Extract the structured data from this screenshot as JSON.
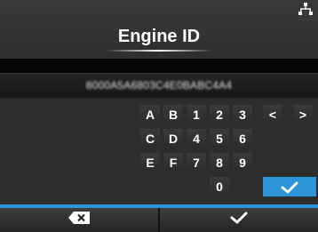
{
  "header": {
    "title": "Engine ID",
    "network_icon": "network-icon"
  },
  "value": {
    "text": "8000A5A6803C4E0BABC4A4"
  },
  "keypad": {
    "rows": [
      [
        "A",
        "B",
        "1",
        "2",
        "3",
        "<",
        ">"
      ],
      [
        "C",
        "D",
        "4",
        "5",
        "6"
      ],
      [
        "E",
        "F",
        "7",
        "8",
        "9"
      ],
      [
        "0"
      ]
    ],
    "enter_icon": "checkmark-icon"
  },
  "softkeys": {
    "left_icon": "backspace-icon",
    "right_icon": "checkmark-icon"
  },
  "colors": {
    "accent": "#2c95d8",
    "background": "#2d2d2d"
  }
}
